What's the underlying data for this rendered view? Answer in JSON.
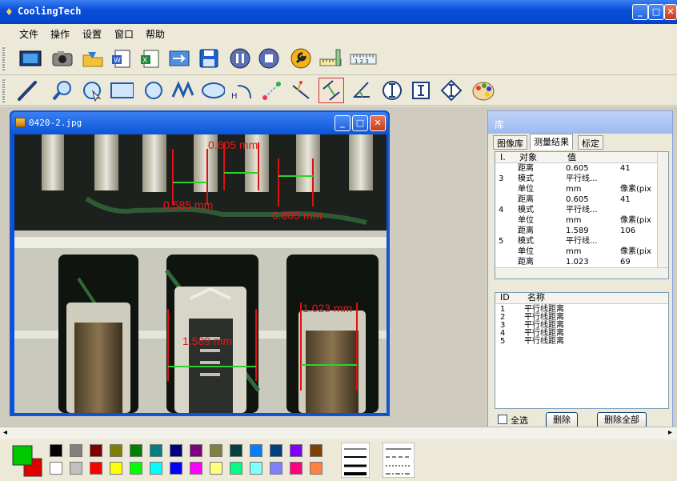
{
  "app": {
    "title": "CoolingTech"
  },
  "menu": [
    "文件",
    "操作",
    "设置",
    "窗口",
    "帮助"
  ],
  "toolbar1": [
    "video-icon",
    "camera-icon",
    "open-folder-icon",
    "word-export-icon",
    "excel-export-icon",
    "swap-icon",
    "save-icon",
    "pause-icon",
    "stop-icon",
    "wrench-icon",
    "ruler-icon",
    "scale-icon"
  ],
  "toolbar2": [
    "line-tool-icon",
    "magnifier-icon",
    "circle-arc-tool-icon",
    "rectangle-tool-icon",
    "circle-tool-icon",
    "polyline-tool-icon",
    "ellipse-tool-icon",
    "angle-h-tool-icon",
    "point-distance-tool-icon",
    "point-line-tool-icon",
    "parallel-lines-tool-icon",
    "angle-tool-icon",
    "horizontal-caliper-icon",
    "vertical-caliper-icon",
    "rotated-caliper-icon",
    "color-palette-icon"
  ],
  "image_window": {
    "title": "0420-2.jpg"
  },
  "measurements": {
    "m1": "0.605 mm",
    "m2": "0.585 mm",
    "m3": "0.605 mm",
    "m4": "1.023 mm",
    "m5": "1.589 mm"
  },
  "library": {
    "title": "库",
    "tabs": [
      "图像库",
      "测量结果",
      "标定"
    ],
    "top_headers": [
      "I.",
      "对象",
      "值"
    ],
    "top_rows": [
      {
        "id": "",
        "obj": "距离",
        "val": "0.605",
        "px": "41"
      },
      {
        "id": "3",
        "obj": "模式",
        "val": "平行线...",
        "px": ""
      },
      {
        "id": "",
        "obj": "单位",
        "val": "mm",
        "px": "像素(pix"
      },
      {
        "id": "",
        "obj": "距离",
        "val": "0.605",
        "px": "41"
      },
      {
        "id": "4",
        "obj": "模式",
        "val": "平行线...",
        "px": ""
      },
      {
        "id": "",
        "obj": "单位",
        "val": "mm",
        "px": "像素(pix"
      },
      {
        "id": "",
        "obj": "距离",
        "val": "1.589",
        "px": "106"
      },
      {
        "id": "5",
        "obj": "模式",
        "val": "平行线...",
        "px": ""
      },
      {
        "id": "",
        "obj": "单位",
        "val": "mm",
        "px": "像素(pix"
      },
      {
        "id": "",
        "obj": "距离",
        "val": "1.023",
        "px": "69"
      }
    ],
    "bottom_headers": [
      "ID",
      "名称"
    ],
    "bottom_rows": [
      {
        "id": "1",
        "name": "平行线距离"
      },
      {
        "id": "2",
        "name": "平行线距离"
      },
      {
        "id": "3",
        "name": "平行线距离"
      },
      {
        "id": "4",
        "name": "平行线距离"
      },
      {
        "id": "5",
        "name": "平行线距离"
      }
    ],
    "select_all": "全选",
    "delete": "删除",
    "delete_all": "删除全部"
  },
  "palette": {
    "fg": "#00c800",
    "bg": "#e00000",
    "row1": [
      "#000000",
      "#808080",
      "#800000",
      "#808000",
      "#008000",
      "#008080",
      "#000080",
      "#800080",
      "#808040",
      "#004040",
      "#0080ff",
      "#004080",
      "#8000ff",
      "#804000"
    ],
    "row2": [
      "#ffffff",
      "#c0c0c0",
      "#ff0000",
      "#ffff00",
      "#00ff00",
      "#00ffff",
      "#0000ff",
      "#ff00ff",
      "#ffff80",
      "#00ff80",
      "#80ffff",
      "#8080ff",
      "#ff0080",
      "#ff8040"
    ]
  }
}
